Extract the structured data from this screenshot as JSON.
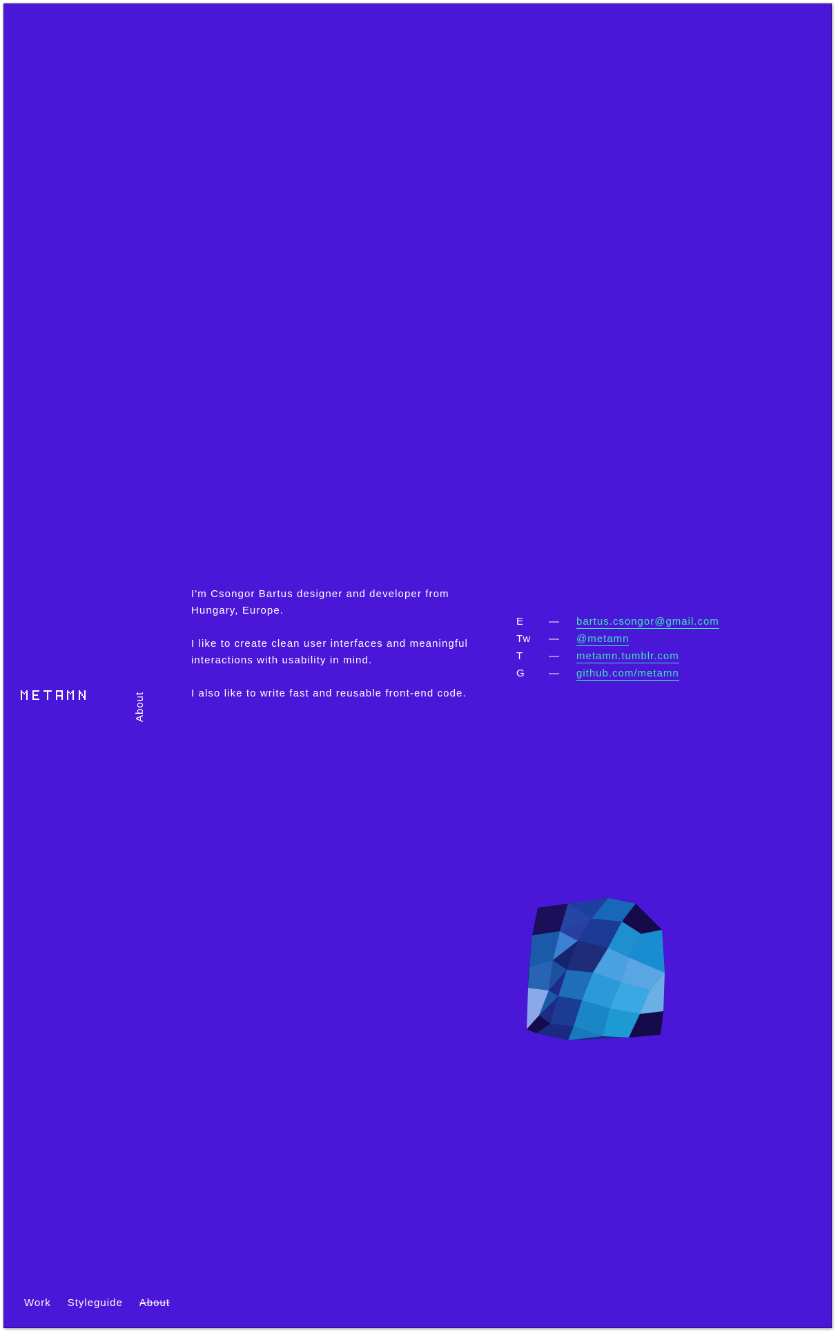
{
  "brand": {
    "logo_text": "METAMN"
  },
  "section": {
    "label": "About"
  },
  "bio": {
    "paragraphs": [
      "I'm Csongor Bartus designer and developer from Hungary, Europe.",
      "I like to create clean user interfaces and meaningful interactions with usability in mind.",
      "I also like to write fast and reusable front-end code."
    ]
  },
  "contacts": [
    {
      "key": "E",
      "dash": "—",
      "value": "bartus.csongor@gmail.com"
    },
    {
      "key": "Tw",
      "dash": "—",
      "value": "@metamn"
    },
    {
      "key": "T",
      "dash": "—",
      "value": "metamn.tumblr.com"
    },
    {
      "key": "G",
      "dash": "—",
      "value": "github.com/metamn"
    }
  ],
  "nav": {
    "items": [
      "Work",
      "Styleguide",
      "About"
    ],
    "current": "About"
  },
  "colors": {
    "background": "#4a17d8",
    "text": "#ffffff",
    "link": "#3de6b8"
  },
  "icons": {
    "gem": "low-poly-gem-illustration"
  }
}
